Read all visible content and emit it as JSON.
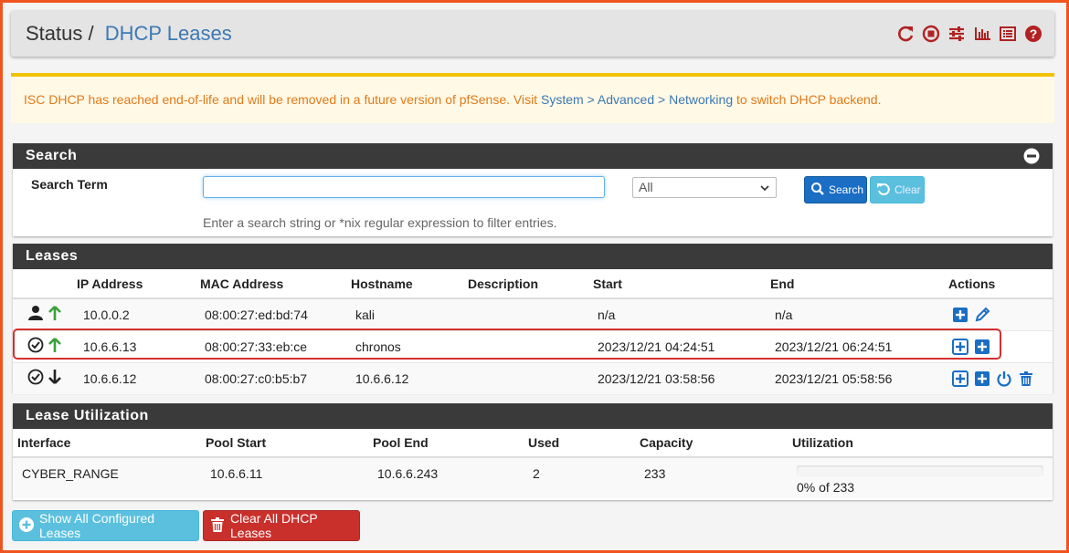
{
  "header": {
    "status_label": "Status",
    "separator": "/",
    "page_title": "DHCP Leases",
    "icons": [
      "refresh-icon",
      "stop-circle-icon",
      "sliders-icon",
      "bar-chart-icon",
      "log-list-icon",
      "help-icon"
    ],
    "icon_color": "#b22222"
  },
  "alert": {
    "text_before": "ISC DHCP has reached end-of-life and will be removed in a future version of pfSense. Visit ",
    "link_text": "System > Advanced > Networking",
    "text_after": " to switch DHCP backend."
  },
  "search": {
    "panel_title": "Search",
    "term_label": "Search Term",
    "input_value": "",
    "select_value": "All",
    "search_button": "Search",
    "clear_button": "Clear",
    "help_text": "Enter a search string or *nix regular expression to filter entries."
  },
  "leases": {
    "panel_title": "Leases",
    "columns": [
      "",
      "IP Address",
      "MAC Address",
      "Hostname",
      "Description",
      "Start",
      "End",
      "Actions"
    ],
    "rows": [
      {
        "status_icons": [
          "user-icon",
          "arrow-up-icon"
        ],
        "ip": "10.0.0.2",
        "mac": "08:00:27:ed:bd:74",
        "hostname": "kali",
        "description": "",
        "start": "n/a",
        "end": "n/a",
        "actions": [
          "add-icon",
          "edit-icon"
        ]
      },
      {
        "status_icons": [
          "check-circle-icon",
          "arrow-up-icon"
        ],
        "ip": "10.6.6.13",
        "mac": "08:00:27:33:eb:ce",
        "hostname": "chronos",
        "description": "",
        "start": "2023/12/21 04:24:51",
        "end": "2023/12/21 06:24:51",
        "actions": [
          "add-icon",
          "add-icon"
        ]
      },
      {
        "status_icons": [
          "check-circle-icon",
          "arrow-down-icon"
        ],
        "ip": "10.6.6.12",
        "mac": "08:00:27:c0:b5:b7",
        "hostname": "10.6.6.12",
        "description": "",
        "start": "2023/12/21 03:58:56",
        "end": "2023/12/21 05:58:56",
        "actions": [
          "add-icon",
          "add-icon",
          "power-icon",
          "trash-icon"
        ]
      }
    ]
  },
  "utilization": {
    "panel_title": "Lease Utilization",
    "columns": [
      "Interface",
      "Pool Start",
      "Pool End",
      "Used",
      "Capacity",
      "Utilization"
    ],
    "rows": [
      {
        "interface": "CYBER_RANGE",
        "pool_start": "10.6.6.11",
        "pool_end": "10.6.6.243",
        "used": "2",
        "capacity": "233",
        "utilization_text": "0% of 233",
        "utilization_percent": 0
      }
    ]
  },
  "buttons": {
    "show_all": "Show All Configured Leases",
    "clear_all": "Clear All DHCP Leases"
  }
}
